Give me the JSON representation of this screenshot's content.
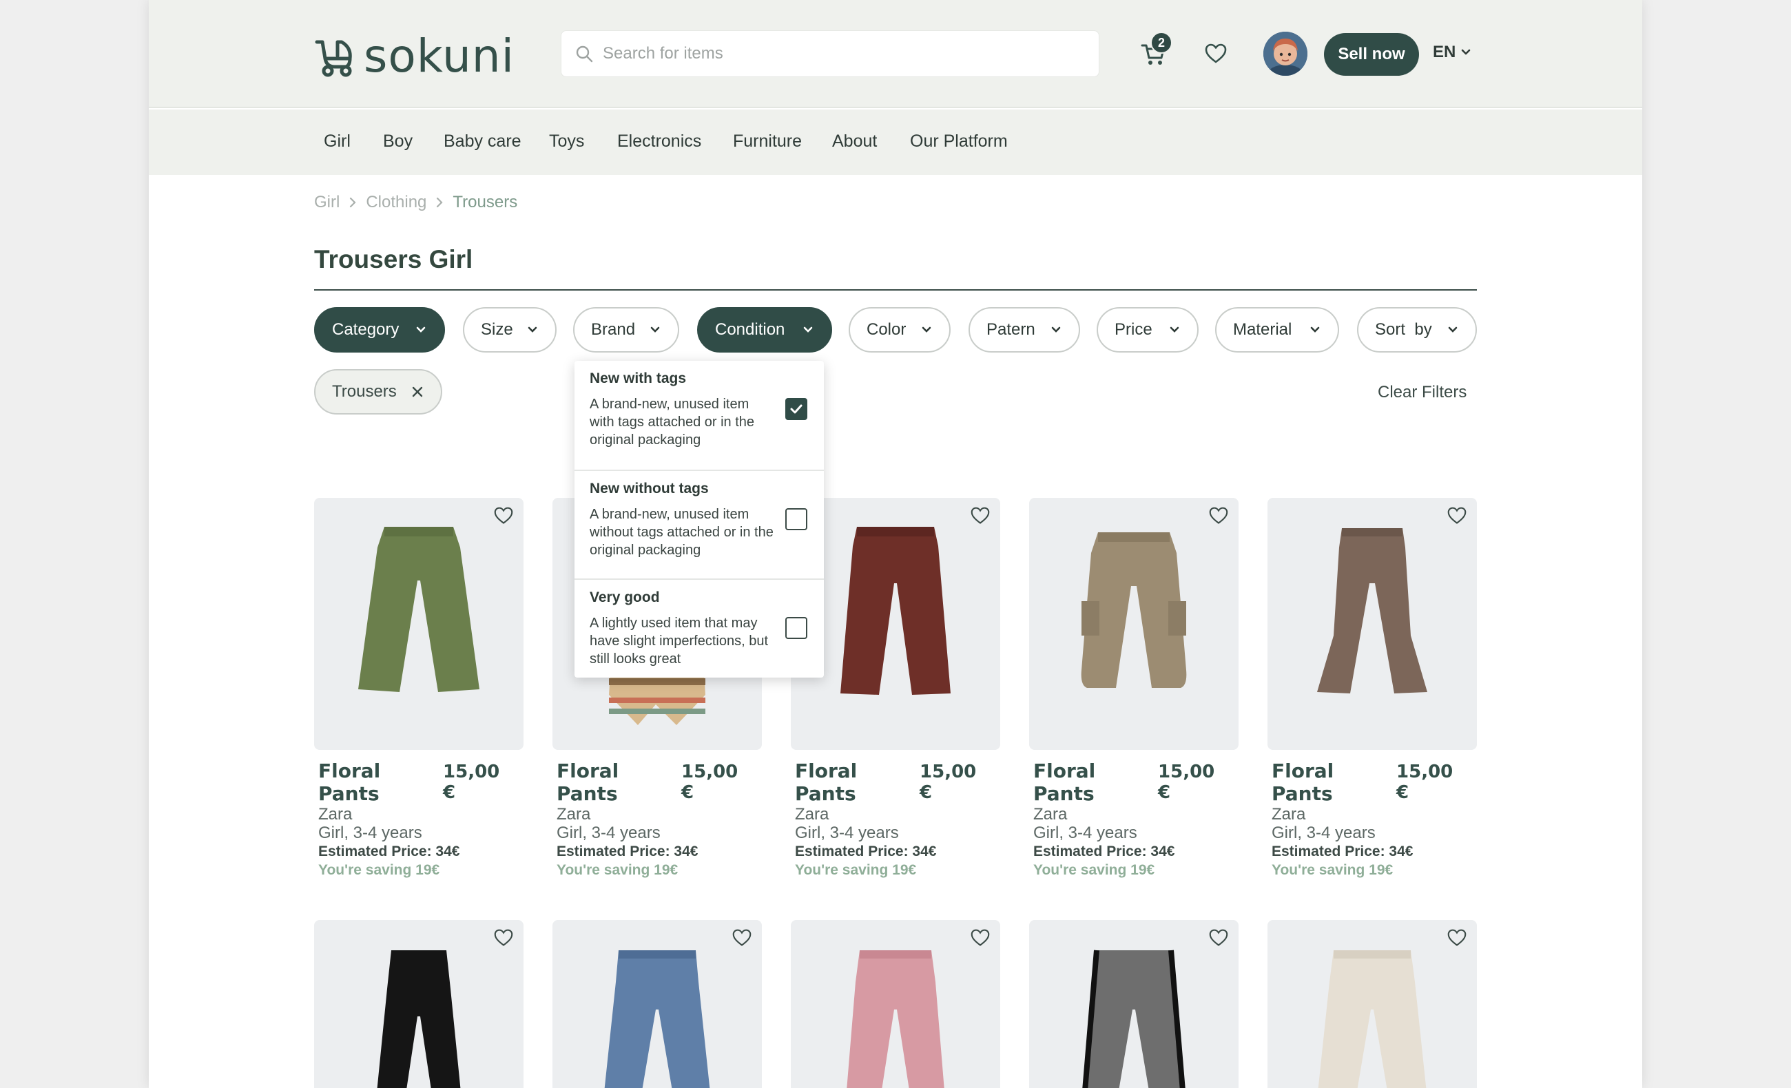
{
  "header": {
    "logo": "sokuni",
    "search_placeholder": "Search for items",
    "cart_count": "2",
    "sell_label": "Sell now",
    "language": "EN"
  },
  "nav": [
    "Girl",
    "Boy",
    "Baby care",
    "Toys",
    "Electronics",
    "Furniture",
    "About",
    "Our Platform"
  ],
  "breadcrumb": [
    "Girl",
    "Clothing",
    "Trousers"
  ],
  "title": "Trousers Girl",
  "filters": [
    "Category",
    "Size",
    "Brand",
    "Condition",
    "Color",
    "Patern",
    "Price",
    "Material",
    "Sort  by"
  ],
  "active_chip": "Trousers",
  "clear_filters": "Clear Filters",
  "condition_menu": [
    {
      "title": "New with tags",
      "desc": "A brand-new, unused item with tags attached or in the original packaging",
      "checked": true
    },
    {
      "title": "New without tags",
      "desc": "A brand-new, unused item without tags attached or in the original packaging",
      "checked": false
    },
    {
      "title": "Very good",
      "desc": "A lightly used item that may have slight imperfections, but still looks great",
      "checked": false
    }
  ],
  "products": [
    {
      "name": "Floral Pants",
      "price": "15,00 €",
      "brand": "Zara",
      "size": "Girl, 3-4 years",
      "estimated": "Estimated Price: 34€",
      "saving": "You're saving 19€",
      "color": "#6b7f4c"
    },
    {
      "name": "Floral Pants",
      "price": "15,00 €",
      "brand": "Zara",
      "size": "Girl, 3-4 years",
      "estimated": "Estimated Price: 34€",
      "saving": "You're saving 19€",
      "color": "#c9a77e"
    },
    {
      "name": "Floral Pants",
      "price": "15,00 €",
      "brand": "Zara",
      "size": "Girl, 3-4 years",
      "estimated": "Estimated Price: 34€",
      "saving": "You're saving 19€",
      "color": "#6e2f28"
    },
    {
      "name": "Floral Pants",
      "price": "15,00 €",
      "brand": "Zara",
      "size": "Girl, 3-4 years",
      "estimated": "Estimated Price: 34€",
      "saving": "You're saving 19€",
      "color": "#9c8c72"
    },
    {
      "name": "Floral Pants",
      "price": "15,00 €",
      "brand": "Zara",
      "size": "Girl, 3-4 years",
      "estimated": "Estimated Price: 34€",
      "saving": "You're saving 19€",
      "color": "#7c6659"
    }
  ],
  "row2_colors": [
    "#151515",
    "#5f7fa8",
    "#d79aa3",
    "#6e6e6e",
    "#e6dfd3"
  ]
}
